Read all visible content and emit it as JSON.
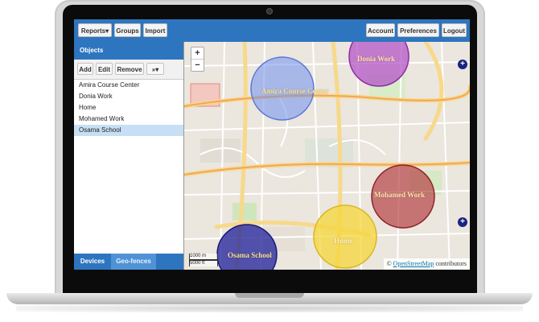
{
  "toolbar": {
    "reports": "Reports",
    "groups": "Groups",
    "import": "Import",
    "account": "Account",
    "preferences": "Preferences",
    "logout": "Logout"
  },
  "panel": {
    "title": "Objects",
    "add": "Add",
    "edit": "Edit",
    "remove": "Remove",
    "more": "»",
    "items": [
      "Amira Course Center",
      "Donia Work",
      "Home",
      "Mohamed Work",
      "Osama School"
    ],
    "selected_item": "Osama School",
    "tabs": [
      "Devices",
      "Geo-fences"
    ],
    "active_tab": "Geo-fences"
  },
  "map": {
    "zoom_in": "+",
    "zoom_out": "−",
    "geofences": [
      {
        "label": "Amira Course Center",
        "color": "#6f8ff0"
      },
      {
        "label": "Donia Work",
        "color": "#b04cc4"
      },
      {
        "label": "Mohamed Work",
        "color": "#b2363a"
      },
      {
        "label": "Home",
        "color": "#f5d53a"
      },
      {
        "label": "Osama School",
        "color": "#2a2a9c"
      }
    ],
    "scale_top": "1000 m",
    "scale_bottom": "5000 ft",
    "attribution_prefix": "©",
    "attribution_link": "OpenStreetMap",
    "attribution_suffix": "contributors",
    "side_button": "+"
  },
  "colors": {
    "primary": "#2e75c0",
    "selected_row": "#c7dff5"
  }
}
